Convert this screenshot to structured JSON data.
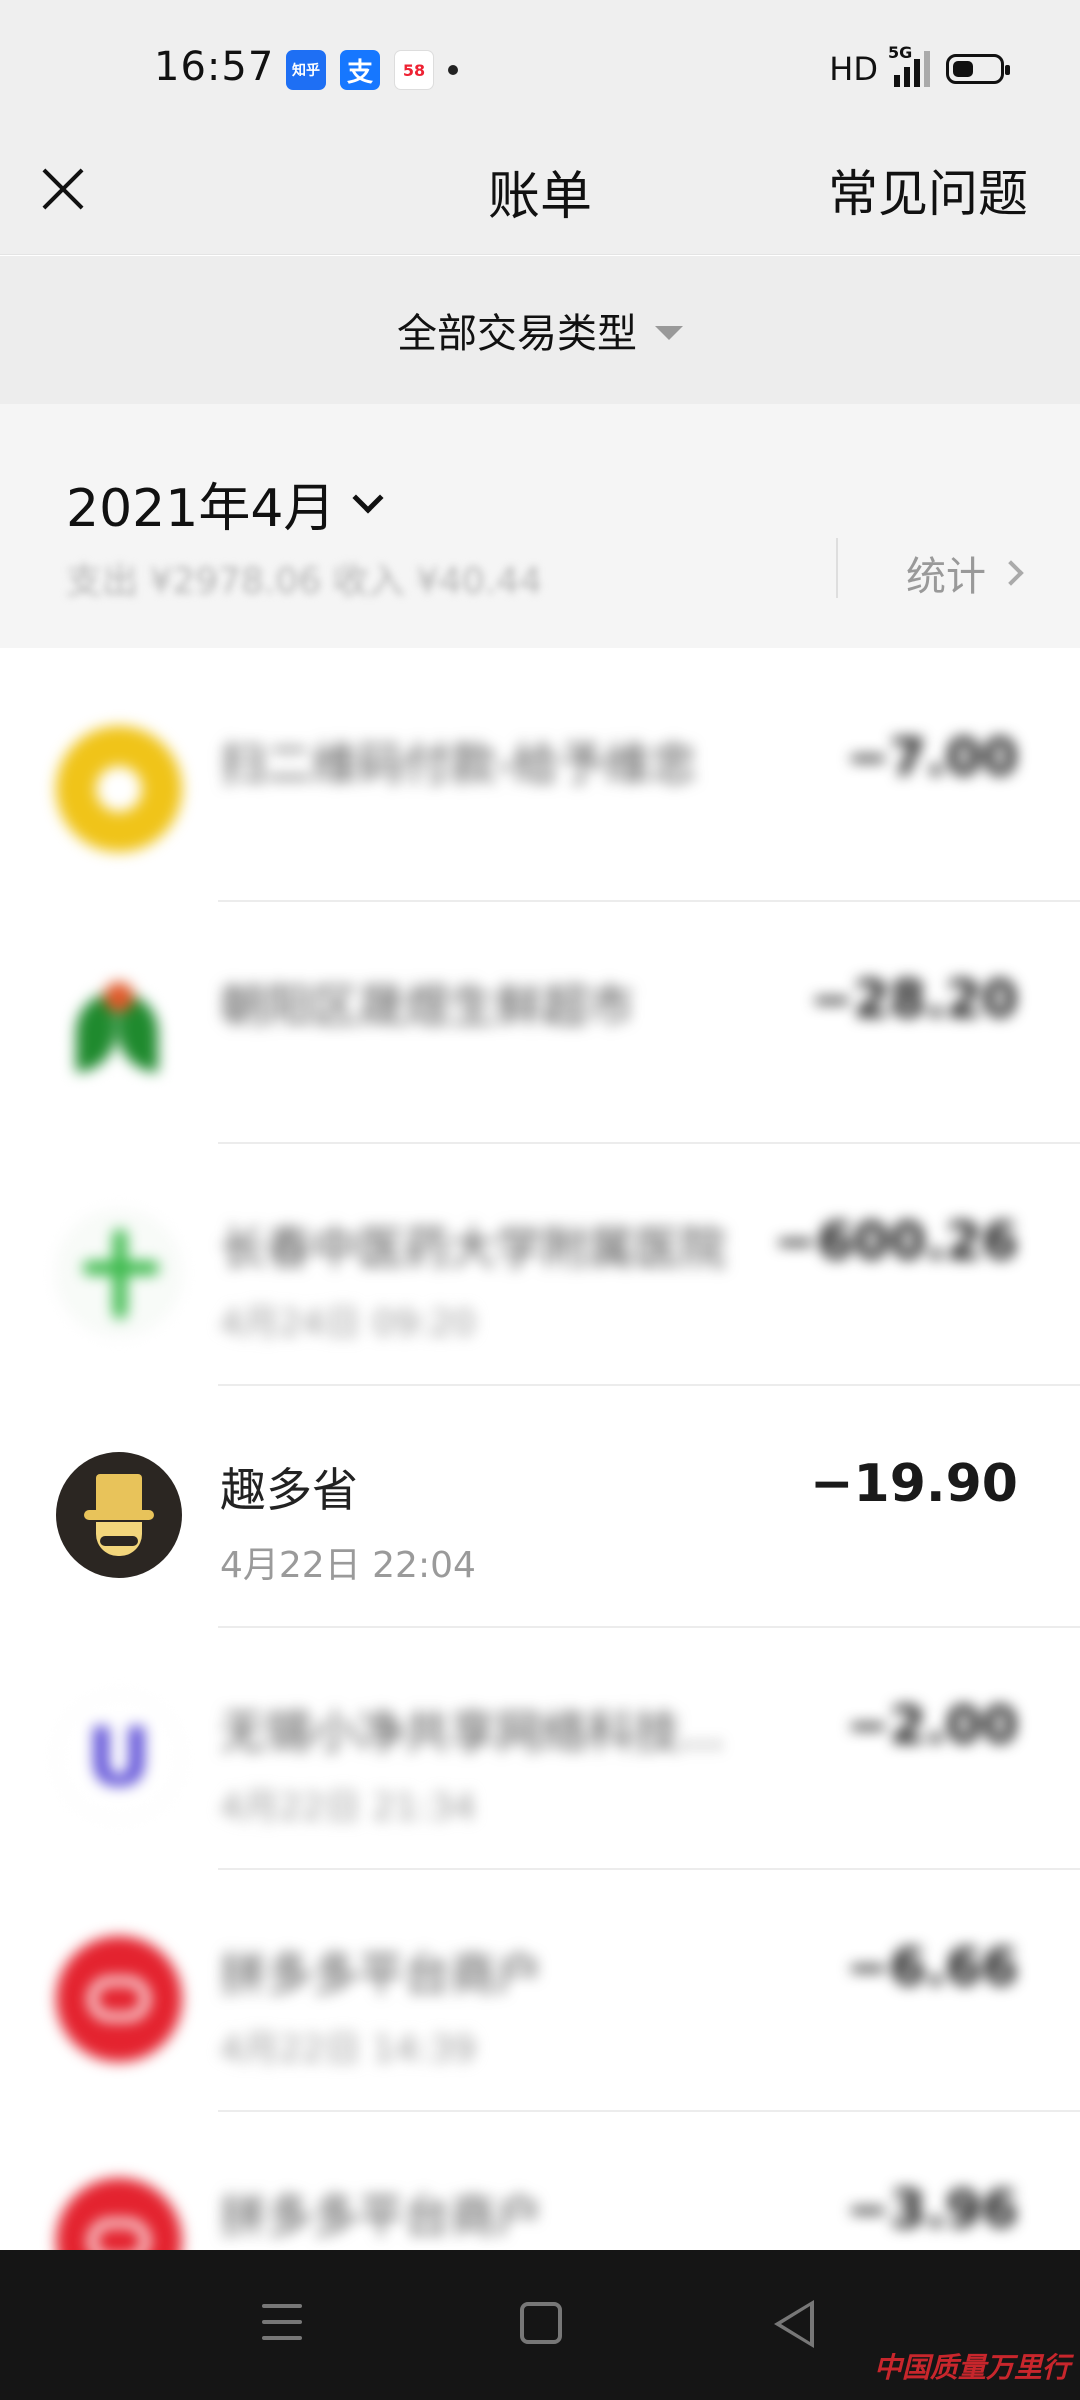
{
  "status_bar": {
    "time": "16:57",
    "apps": [
      {
        "name": "zhihu",
        "label": "知乎",
        "color": "#1e6ff4"
      },
      {
        "name": "alipay",
        "label": "支",
        "color": "#1677ff"
      },
      {
        "name": "58",
        "label": "58",
        "color": "#ffffff"
      }
    ],
    "hd": "HD",
    "network": "5G"
  },
  "nav": {
    "title": "账单",
    "faq": "常见问题"
  },
  "filter": {
    "label": "全部交易类型"
  },
  "month": {
    "label": "2021年4月",
    "summary": "支出 ¥2978.06 收入 ¥40.44",
    "stats_label": "统计"
  },
  "transactions": [
    {
      "name": "扫二维码付款-给予维忠",
      "time": "",
      "amount": "−7.00",
      "blurred": true,
      "icon": "wallet-icon"
    },
    {
      "name": "朝阳区晟煜生鲜超市",
      "time": "",
      "amount": "−28.20",
      "blurred": true,
      "icon": "bank-logo-icon"
    },
    {
      "name": "长春中医药大学附属医院",
      "time": "4月24日 09:20",
      "amount": "−600.26",
      "blurred": true,
      "icon": "medical-cross-icon"
    },
    {
      "name": "趣多省",
      "time": "4月22日 22:04",
      "amount": "−19.90",
      "blurred": false,
      "icon": "top-hat-gentleman-icon"
    },
    {
      "name": "无锡小净共享网络科技...",
      "time": "4月22日 21:34",
      "amount": "−2.00",
      "blurred": true,
      "icon": "u-logo-icon"
    },
    {
      "name": "拼多多平台商户",
      "time": "4月22日 14:39",
      "amount": "−6.66",
      "blurred": true,
      "icon": "pinduoduo-icon"
    },
    {
      "name": "拼多多平台商户",
      "time": "",
      "amount": "−3.96",
      "blurred": true,
      "icon": "pinduoduo-icon"
    }
  ],
  "watermark": "中国质量万里行",
  "colors": {
    "accent_text": "#111111",
    "muted_text": "#999999",
    "header_bg": "#efefef",
    "nav_bg": "#151515"
  }
}
